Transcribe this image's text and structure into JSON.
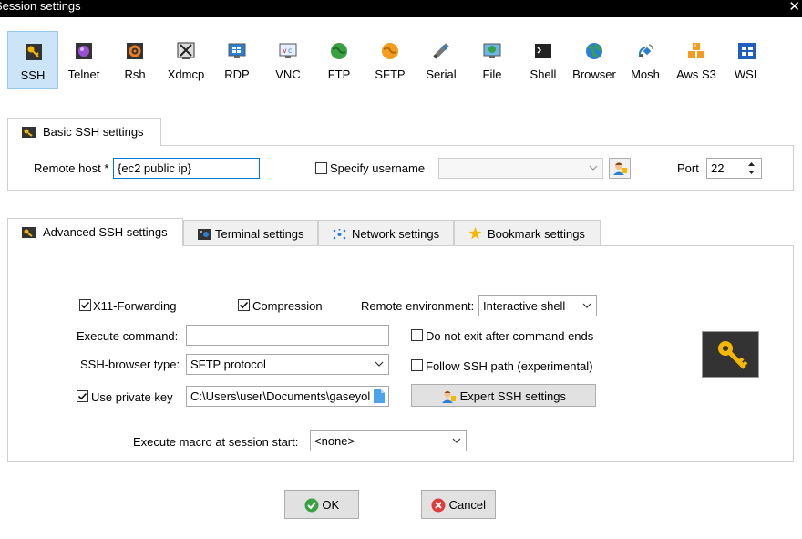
{
  "window": {
    "title": "Session settings",
    "close_glyph": "✕"
  },
  "session_types": [
    {
      "label": "SSH",
      "icon": "ssh-key-icon",
      "active": true
    },
    {
      "label": "Telnet",
      "icon": "telnet-icon"
    },
    {
      "label": "Rsh",
      "icon": "rsh-icon"
    },
    {
      "label": "Xdmcp",
      "icon": "xdmcp-icon"
    },
    {
      "label": "RDP",
      "icon": "rdp-monitor-icon"
    },
    {
      "label": "VNC",
      "icon": "vnc-monitor-icon"
    },
    {
      "label": "FTP",
      "icon": "ftp-globe-icon"
    },
    {
      "label": "SFTP",
      "icon": "sftp-globe-icon"
    },
    {
      "label": "Serial",
      "icon": "serial-plug-icon"
    },
    {
      "label": "File",
      "icon": "file-monitor-icon"
    },
    {
      "label": "Shell",
      "icon": "shell-terminal-icon"
    },
    {
      "label": "Browser",
      "icon": "browser-globe-icon"
    },
    {
      "label": "Mosh",
      "icon": "mosh-satellite-icon"
    },
    {
      "label": "Aws S3",
      "icon": "aws-cubes-icon"
    },
    {
      "label": "WSL",
      "icon": "windows-logo-icon"
    }
  ],
  "basic": {
    "tab_label": "Basic SSH settings",
    "remote_host_label": "Remote host *",
    "remote_host_value": "{ec2 public ip}",
    "specify_username_label": "Specify username",
    "specify_username_checked": false,
    "username_value": "",
    "port_label": "Port",
    "port_value": "22"
  },
  "advanced_tabs": [
    {
      "label": "Advanced SSH settings",
      "icon": "wrench-key-icon",
      "selected": true
    },
    {
      "label": "Terminal settings",
      "icon": "terminal-icon"
    },
    {
      "label": "Network settings",
      "icon": "network-icon"
    },
    {
      "label": "Bookmark settings",
      "icon": "star-icon"
    }
  ],
  "advanced": {
    "x11_label": "X11-Forwarding",
    "x11_checked": true,
    "compression_label": "Compression",
    "compression_checked": true,
    "remote_env_label": "Remote environment:",
    "remote_env_value": "Interactive shell",
    "execute_command_label": "Execute command:",
    "execute_command_value": "",
    "do_not_exit_label": "Do not exit after command ends",
    "do_not_exit_checked": false,
    "browser_type_label": "SSH-browser type:",
    "browser_type_value": "SFTP protocol",
    "follow_path_label": "Follow SSH path (experimental)",
    "follow_path_checked": false,
    "use_private_key_label": "Use private key",
    "use_private_key_checked": true,
    "private_key_value": "C:\\Users\\user\\Documents\\gaseyol",
    "expert_button_label": "Expert SSH settings",
    "macro_label": "Execute macro at session start:",
    "macro_value": "<none>"
  },
  "footer": {
    "ok_label": "OK",
    "cancel_label": "Cancel"
  },
  "colors": {
    "accent": "#0078d7",
    "active_tile": "#cce4f7",
    "key_badge": "#333333",
    "key_gold": "#f5b800"
  }
}
